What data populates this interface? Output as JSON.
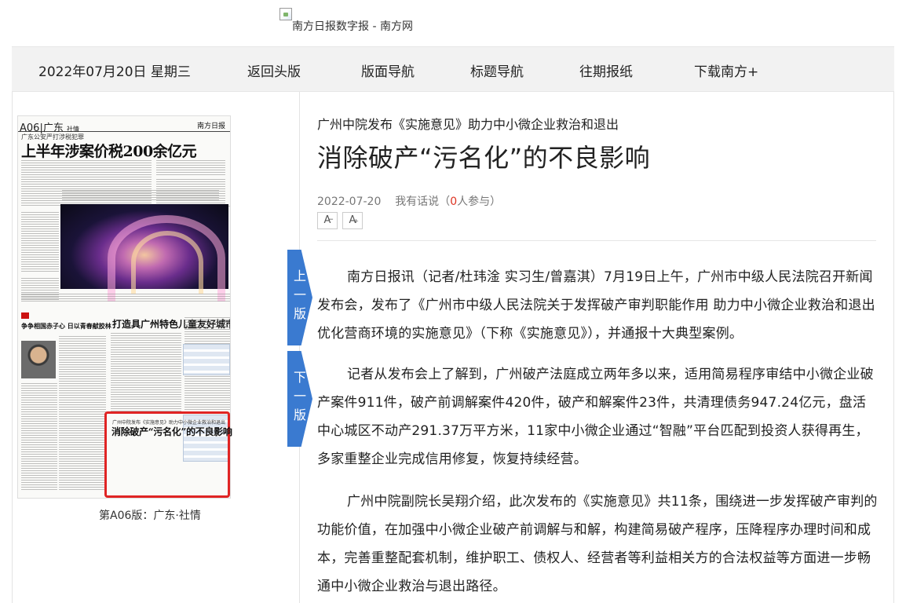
{
  "header": {
    "logo_alt": "南方日报数字报 - 南方网"
  },
  "nav": {
    "date": "2022年07月20日 星期三",
    "back_home": "返回头版",
    "page_nav": "版面导航",
    "title_nav": "标题导航",
    "archive": "往期报纸",
    "download": "下载南方+"
  },
  "page_preview": {
    "page_label": "A06",
    "section_tag": "广东",
    "section_tag2": "社情",
    "masthead": "南方日报",
    "main_headline": "上半年涉案价税200余亿元",
    "kicker": "广东公安严打涉税犯罪",
    "highlight_subtitle": "广州中院发布《实施意见》助力中小微企业救治和退出",
    "highlight_title": "消除破产“污名化”的不良影响",
    "story2_headline": "打造具广州特色儿童友好城市",
    "story3_headline": "争争相国赤子心 日以青春献胶林",
    "caption": "第A06版：广东·社情"
  },
  "pager": {
    "prev": [
      "上",
      "一",
      "版"
    ],
    "next": [
      "下",
      "一",
      "版"
    ]
  },
  "article": {
    "subtitle": "广州中院发布《实施意见》助力中小微企业救治和退出",
    "title": "消除破产“污名化”的不良影响",
    "date": "2022-07-20",
    "comment_prefix": "我有话说（",
    "comment_count": "0",
    "comment_suffix": "人参与）",
    "font_smaller": "A",
    "font_larger": "A",
    "paragraphs": [
      "南方日报讯（记者/杜玮淦 实习生/曾嘉淇）7月19日上午，广州市中级人民法院召开新闻发布会，发布了《广州市中级人民法院关于发挥破产审判职能作用 助力中小微企业救治和退出 优化营商环境的实施意见》（下称《实施意见》），并通报十大典型案例。",
      "记者从发布会上了解到，广州破产法庭成立两年多以来，适用简易程序审结中小微企业破产案件911件，破产前调解案件420件，破产和解案件23件，共清理债务947.24亿元，盘活中心城区不动产291.37万平方米，11家中小微企业通过“智融”平台匹配到投资人获得再生，多家重整企业完成信用修复，恢复持续经营。",
      "广州中院副院长吴翔介绍，此次发布的《实施意见》共11条，围绕进一步发挥破产审判的功能价值，在加强中小微企业破产前调解与和解，构建简易破产程序，压降程序办理时间和成本，完善重整配套机制，维护职工、债权人、经营者等利益相关方的合法权益等方面进一步畅通中小微企业救治与退出路径。"
    ]
  },
  "colors": {
    "nav_bg": "#f2f2f2",
    "pager_blue": "#3a7ad0",
    "highlight_red": "#e02424",
    "comment_count_red": "#dd3322"
  }
}
